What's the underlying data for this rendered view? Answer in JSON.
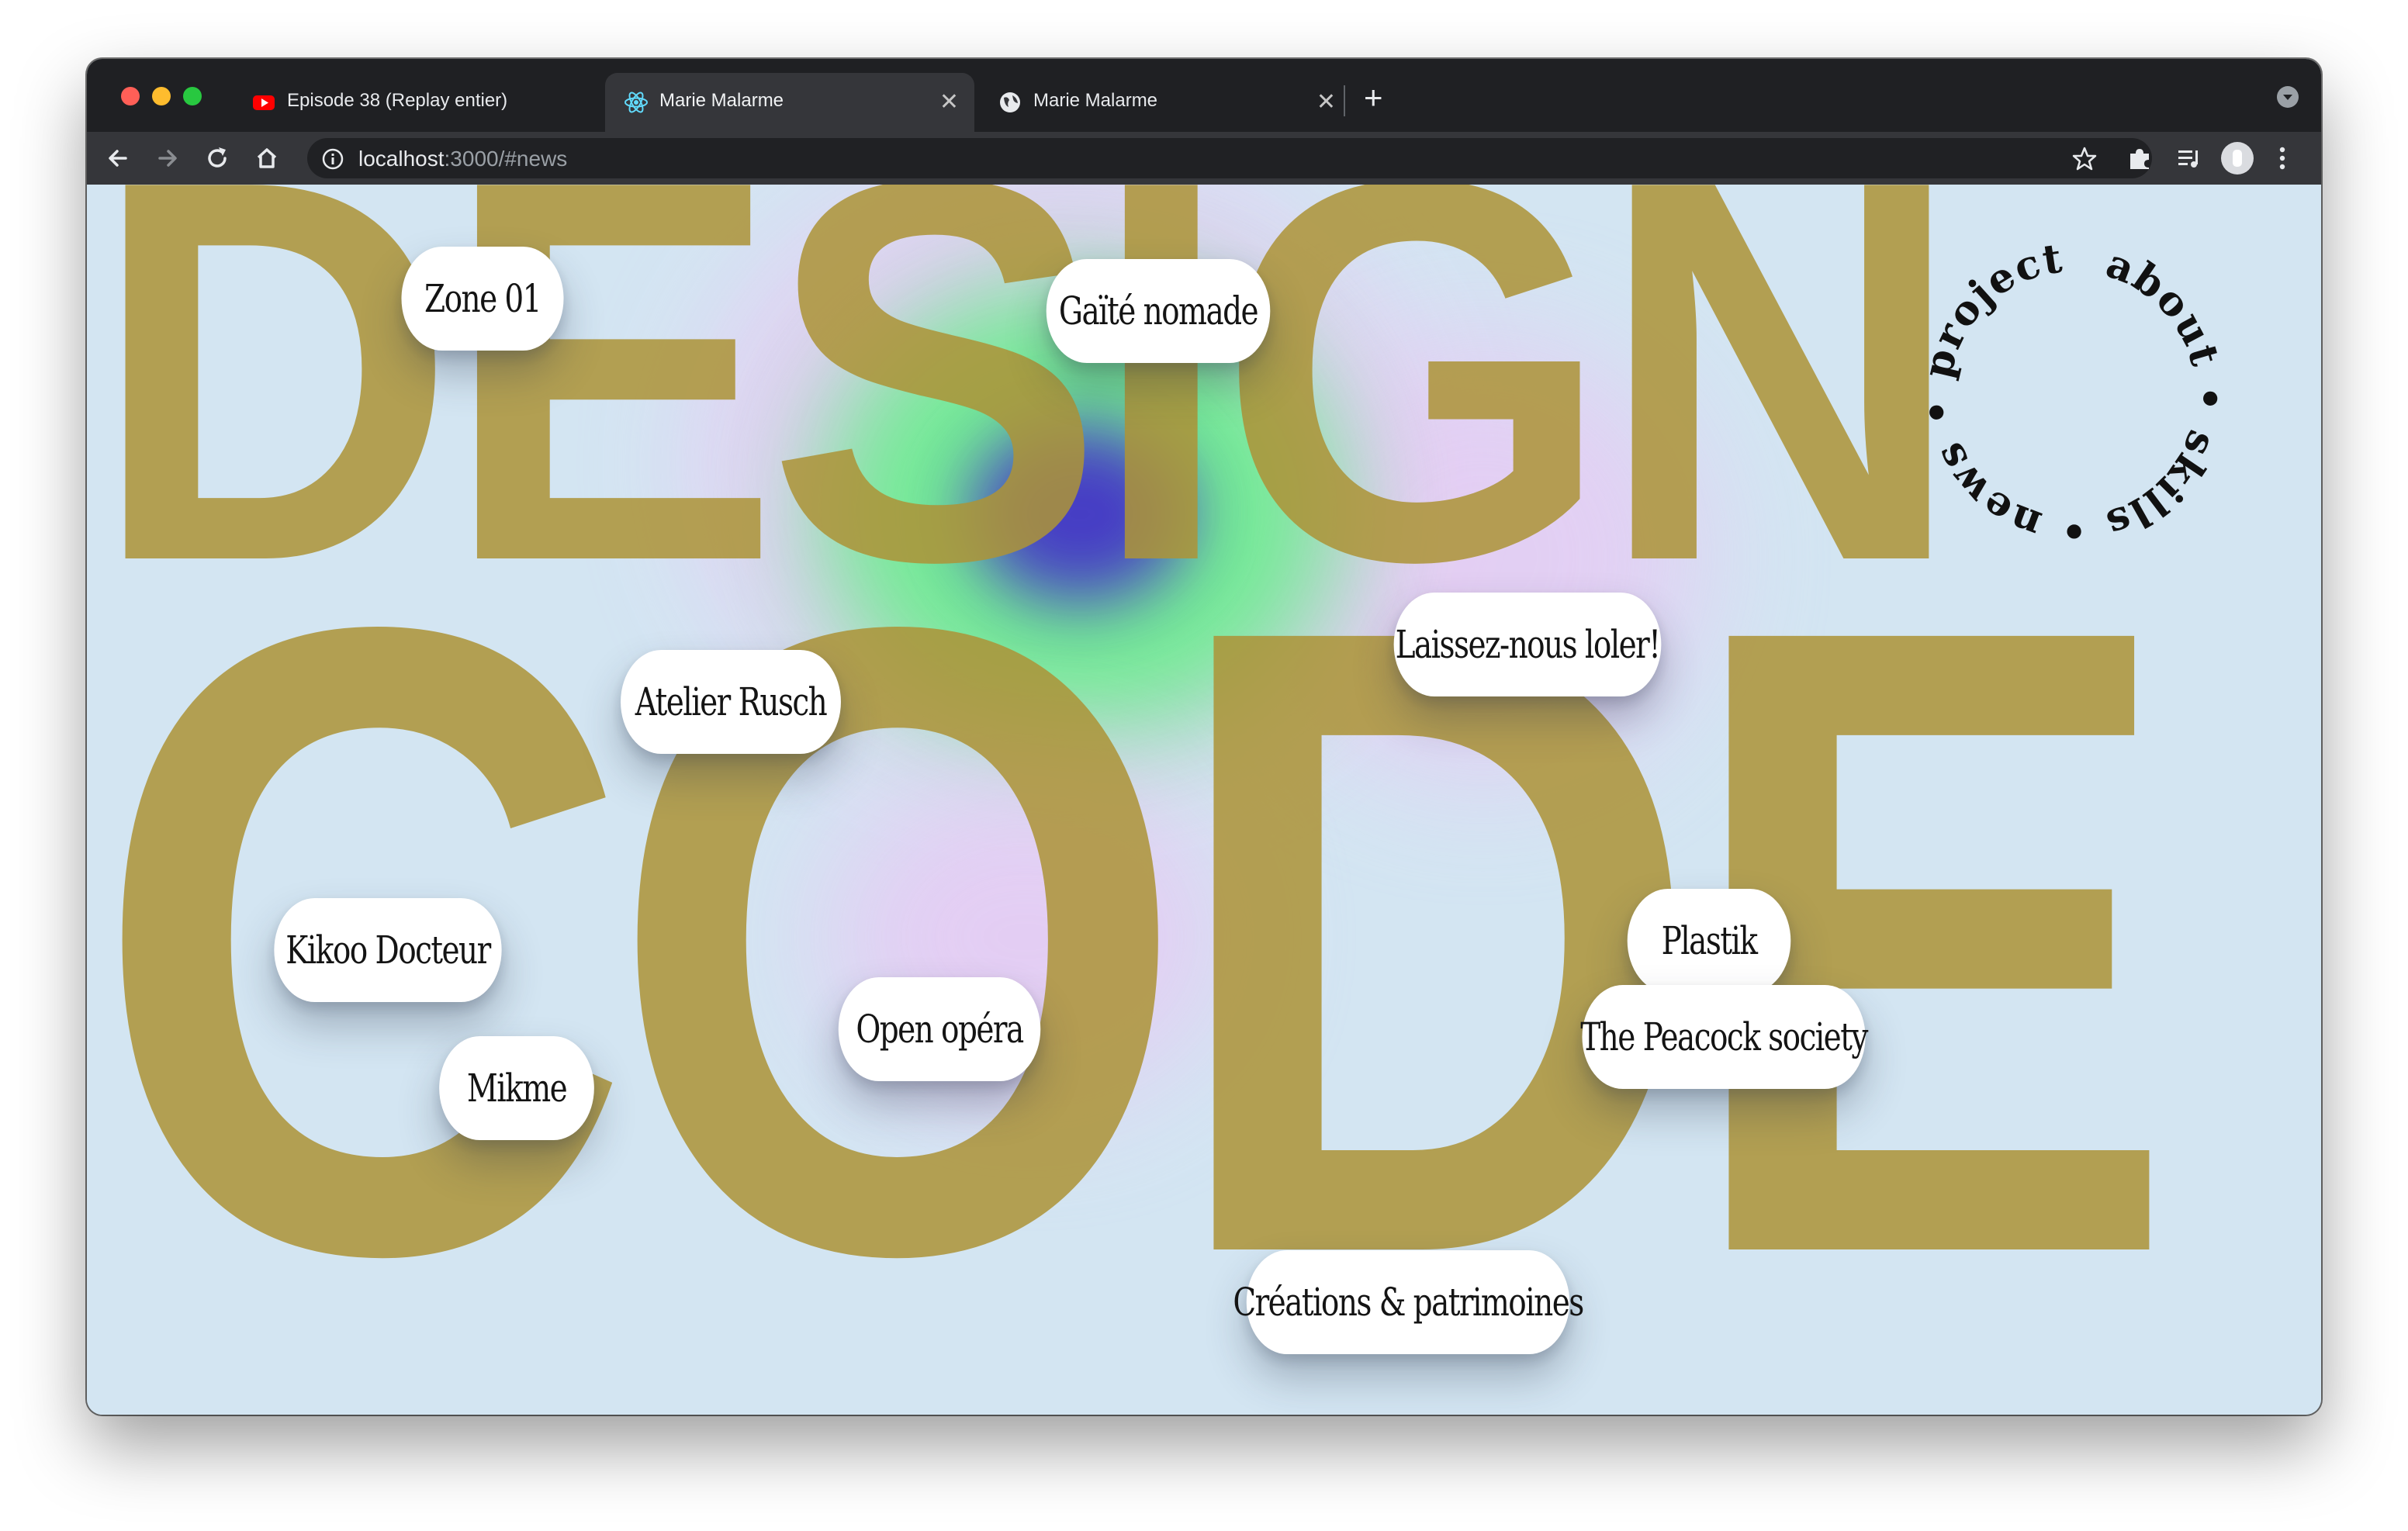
{
  "browser": {
    "tabs": [
      {
        "title": "Episode 38 (Replay entier)",
        "favicon": "youtube-icon"
      },
      {
        "title": "Marie Malarme",
        "favicon": "react-icon",
        "active": true
      },
      {
        "title": "Marie Malarme",
        "favicon": "globe-icon"
      }
    ],
    "close_glyph": "✕",
    "new_tab_glyph": "+",
    "url_host": "localhost",
    "url_rest": ":3000/#news"
  },
  "page": {
    "background_words": [
      "DESIGN",
      "CODE"
    ],
    "nav_ring": [
      "about",
      "skills",
      "news",
      "projects"
    ],
    "separator": "•",
    "projects": [
      "Zone 01",
      "Gaïté nomade",
      "Atelier Rusch",
      "Laissez-nous loler!",
      "Kikoo Docteur",
      "Mikme",
      "Open opéra",
      "Plastik",
      "The Peacock society",
      "Créations & patrimoines"
    ]
  },
  "colors": {
    "background": "#d3e5f2",
    "letters": "#ad9438",
    "pill": "#ffffff",
    "gradient_green": "#66ee8a",
    "gradient_blue": "#4434c8",
    "gradient_pink": "#e8c8f4"
  }
}
